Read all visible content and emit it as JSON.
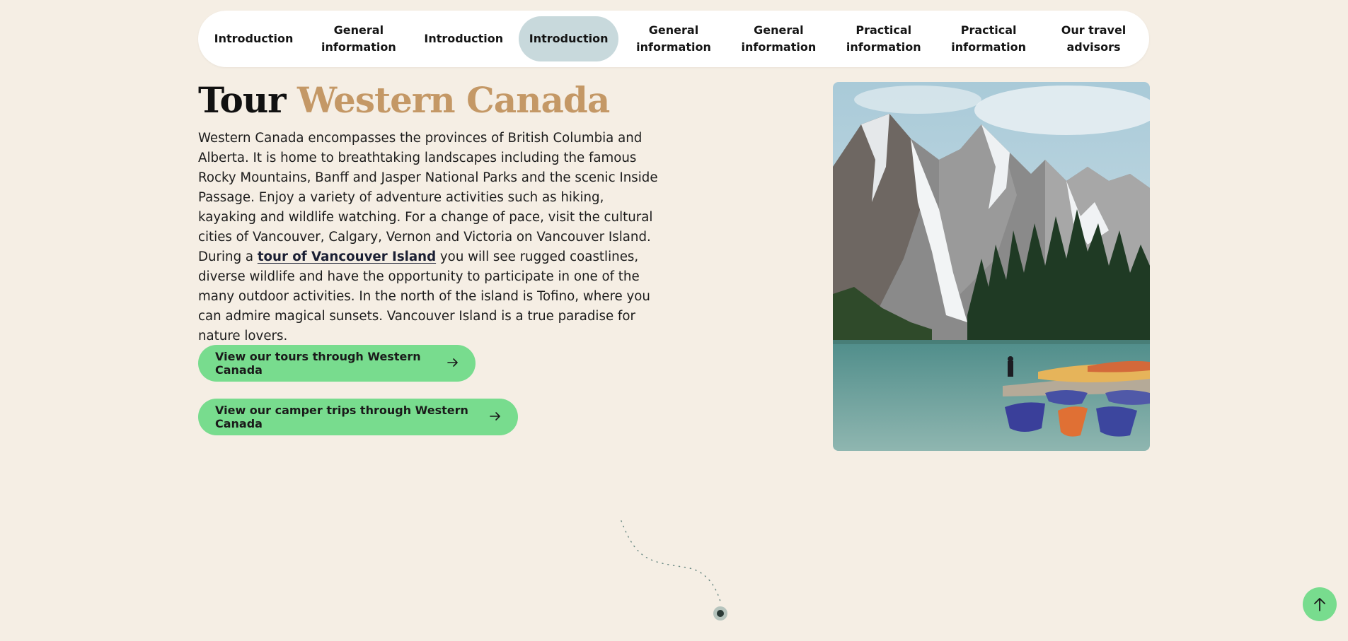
{
  "nav": {
    "items": [
      {
        "label": "Introduction"
      },
      {
        "label": "General information"
      },
      {
        "label": "Introduction"
      },
      {
        "label": "Introduction",
        "active": true
      },
      {
        "label": "General information"
      },
      {
        "label": "General information"
      },
      {
        "label": "Practical information"
      },
      {
        "label": "Practical information"
      },
      {
        "label": "Our travel advisors"
      }
    ]
  },
  "hero": {
    "title_part1": "Tour",
    "title_part2": "Western Canada",
    "body_before_link": "Western Canada encompasses the provinces of British Columbia and Alberta. It is home to breathtaking landscapes including the famous Rocky Mountains, Banff and Jasper National Parks and the scenic Inside Passage. Enjoy a variety of adventure activities such as hiking, kayaking and wildlife watching. For a change of pace, visit the cultural cities of Vancouver, Calgary, Vernon and Victoria on Vancouver Island. During a",
    "link_text": "tour of Vancouver Island",
    "body_after_link": "you will see rugged coastlines, diverse wildlife and have the opportunity to participate in one of the many outdoor activities. In the north of the island is Tofino, where you can admire magical sunsets. Vancouver Island is a true paradise for nature lovers.",
    "button_tours": "View our tours through Western Canada",
    "button_camper": "View our camper trips through Western Canada"
  },
  "icons": {
    "button_arrow": "arrow-right-icon",
    "scroll_top": "arrow-up-icon"
  },
  "colors": {
    "background": "#f5eee4",
    "accent_title": "#c49866",
    "button": "#78dc8e",
    "nav_active": "#c8d9dc"
  }
}
